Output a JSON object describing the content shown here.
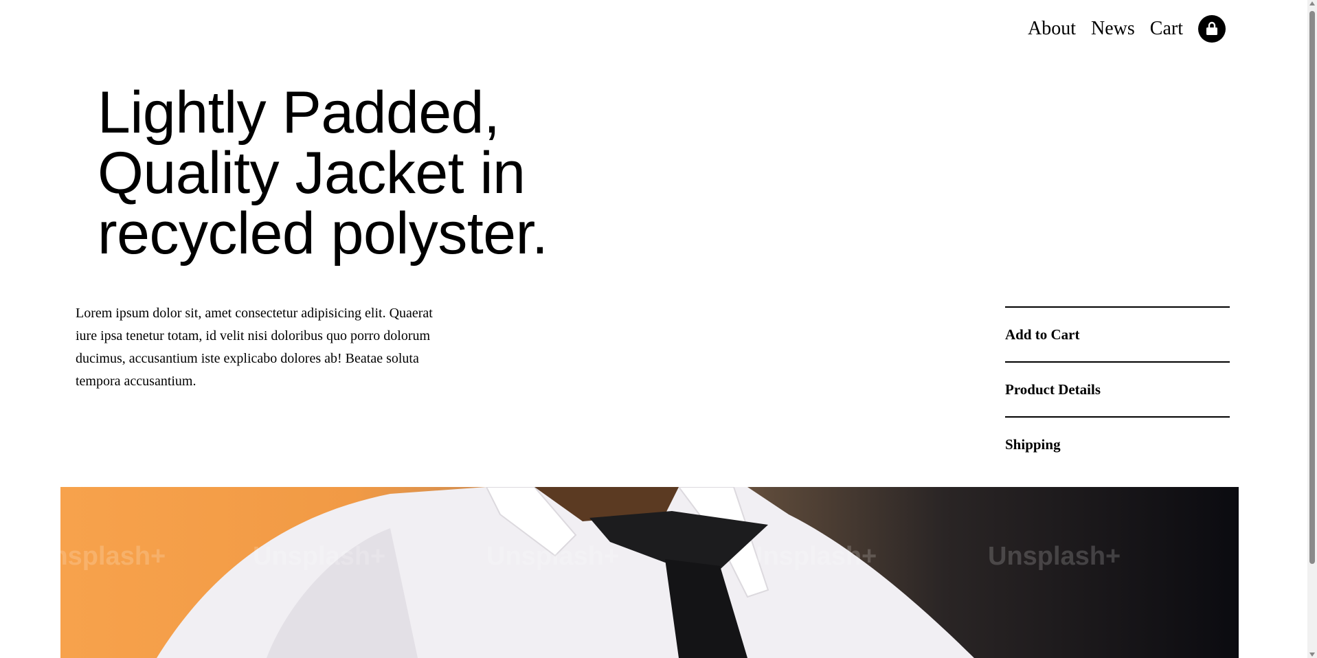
{
  "nav": {
    "items": [
      {
        "label": "About"
      },
      {
        "label": "News"
      },
      {
        "label": "Cart"
      }
    ],
    "bag_icon": "shopping-bag-icon"
  },
  "product": {
    "title": "Lightly Padded, Quality Jacket in recycled polyster.",
    "description": "Lorem ipsum dolor sit, amet consectetur adipisicing elit. Quaerat iure ipsa tenetur totam, id velit nisi doloribus quo porro dolorum ducimus, accusantium iste explicabo dolores ab! Beatae soluta tempora accusantium."
  },
  "actions": [
    {
      "label": "Add to Cart"
    },
    {
      "label": "Product Details"
    },
    {
      "label": "Shipping"
    }
  ],
  "hero": {
    "watermarks": [
      "Unsplash+",
      "Unsplash+",
      "Unsplash+",
      "Unsplash+",
      "Unsplash+"
    ]
  },
  "colors": {
    "background": "#ffffff",
    "text": "#000000",
    "hero_orange": "#f7a24c",
    "hero_dark": "#0b0b10"
  }
}
